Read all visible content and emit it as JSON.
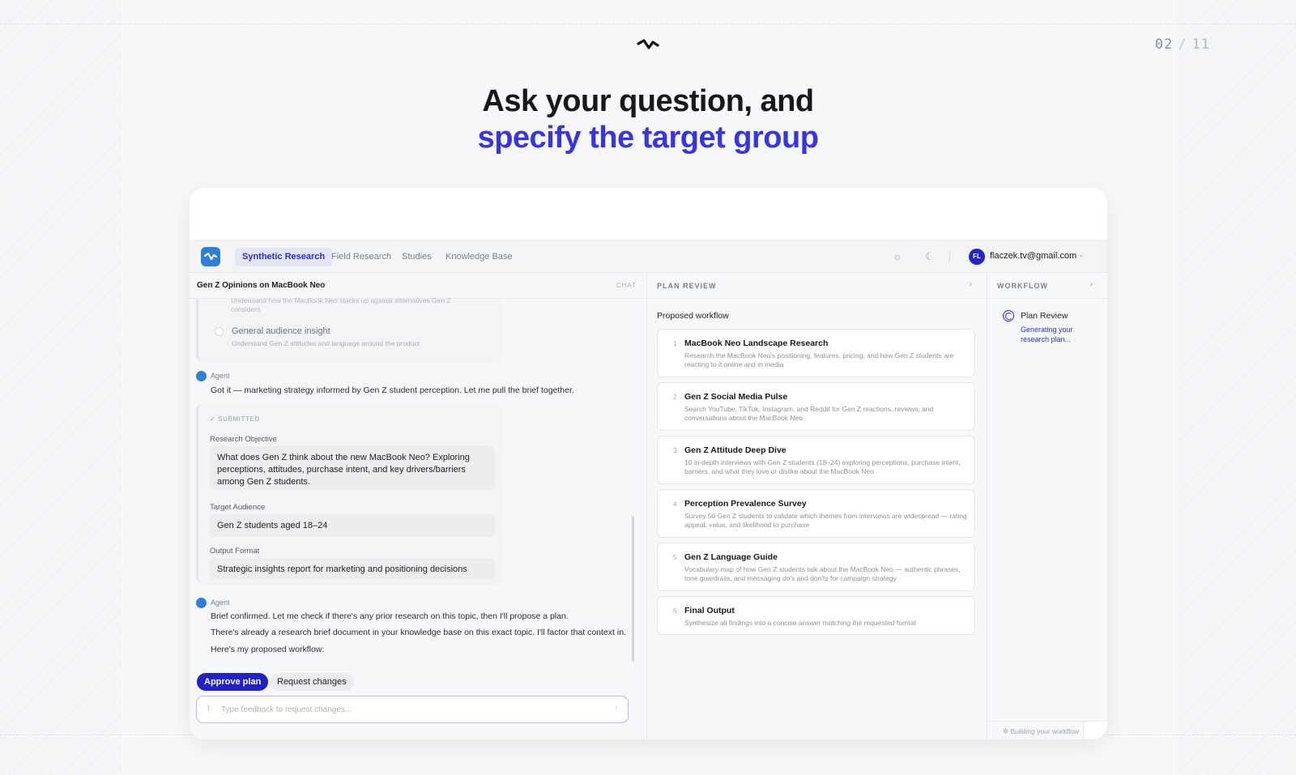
{
  "pager": {
    "current": "02",
    "separator": "/",
    "total": "11"
  },
  "hero": {
    "line1": "Ask your question, and",
    "line2": "specify the target group"
  },
  "nav": {
    "tabs": [
      "Synthetic Research",
      "Field Research",
      "Studies",
      "Knowledge Base"
    ],
    "user_initials": "FL",
    "user_email": "flaczek.tv@gmail.com"
  },
  "chat": {
    "title": "Gen Z Opinions on MacBook Neo",
    "tag": "CHAT",
    "truncated_option_desc_1": "Understand how the MacBook Neo stacks up against alternatives Gen Z",
    "truncated_option_desc_2": "considers",
    "option": {
      "title": "General audience insight",
      "desc": "Understand Gen Z attitudes and language around the product"
    },
    "agent_label": "Agent",
    "msg1": "Got it — marketing strategy informed by Gen Z student perception. Let me pull the brief together.",
    "submitted": "SUBMITTED",
    "brief": {
      "objective_label": "Research Objective",
      "objective": "What does Gen Z think about the new MacBook Neo? Exploring perceptions, attitudes, purchase intent, and key drivers/barriers among Gen Z students.",
      "audience_label": "Target Audience",
      "audience": "Gen Z students aged 18–24",
      "format_label": "Output Format",
      "format": "Strategic insights report for marketing and positioning decisions"
    },
    "msg2": "Brief confirmed. Let me check if there's any prior research on this topic, then I'll propose a plan.",
    "msg3": "There's already a research brief document in your knowledge base on this exact topic. I'll factor that context in.",
    "msg4": "Here's my proposed workflow:",
    "approve": "Approve plan",
    "request": "Request changes",
    "input_placeholder": "Type feedback to request changes..."
  },
  "plan": {
    "header": "PLAN REVIEW",
    "proposed": "Proposed workflow",
    "steps": [
      {
        "n": "1",
        "title": "MacBook Neo Landscape Research",
        "desc": "Research the MacBook Neo's positioning, features, pricing, and how Gen Z students are reacting to it online and in media"
      },
      {
        "n": "2",
        "title": "Gen Z Social Media Pulse",
        "desc": "Search YouTube, TikTok, Instagram, and Reddit for Gen Z reactions, reviews, and conversations about the MacBook Neo"
      },
      {
        "n": "3",
        "title": "Gen Z Attitude Deep Dive",
        "desc": "10 in-depth interviews with Gen Z students (18–24) exploring perceptions, purchase intent, barriers, and what they love or dislike about the MacBook Neo"
      },
      {
        "n": "4",
        "title": "Perception Prevalence Survey",
        "desc": "Survey 50 Gen Z students to validate which themes from interviews are widespread — rating appeal, value, and likelihood to purchase"
      },
      {
        "n": "5",
        "title": "Gen Z Language Guide",
        "desc": "Vocabulary map of how Gen Z students talk about the MacBook Neo — authentic phrases, tone guardrails, and messaging do's and don'ts for campaign strategy"
      },
      {
        "n": "6",
        "title": "Final Output",
        "desc": "Synthesize all findings into a concise answer matching the requested format"
      }
    ]
  },
  "workflow": {
    "header": "WORKFLOW",
    "item_title": "Plan Review",
    "item_status": "Generating your research plan...",
    "footer": "Building your workflow"
  }
}
